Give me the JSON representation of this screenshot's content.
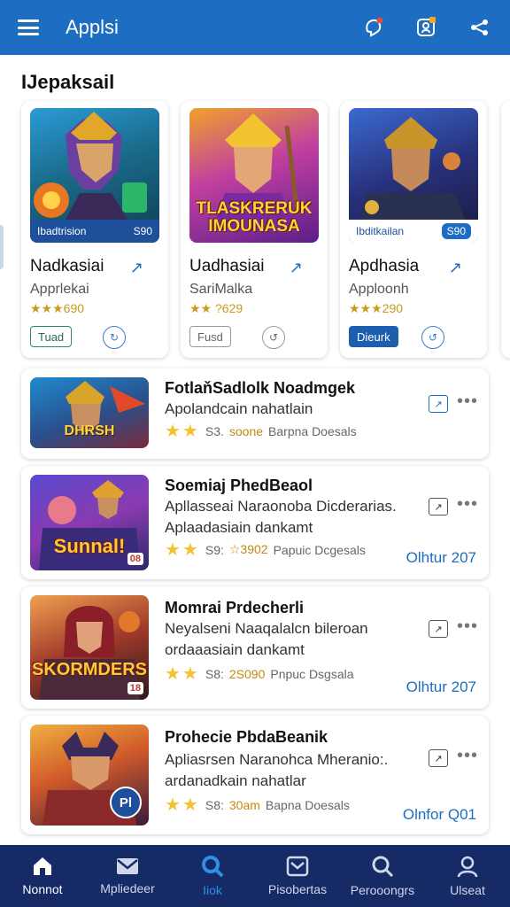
{
  "header": {
    "title": "Applsi",
    "icons": [
      "menu-icon",
      "notification-icon",
      "profile-icon",
      "share-icon"
    ]
  },
  "section_title": "IJepaksail",
  "featured": [
    {
      "art_caption": "Ibadtrision",
      "art_badge": "S90",
      "name": "Nadkasiai",
      "sub": "Apprlekai",
      "rating": "★★★690",
      "button": "Tuad",
      "circle": "↻"
    },
    {
      "art_caption": "TLASKRERUK IMOUNASA",
      "art_badge": "",
      "name": "Uadhasiai",
      "sub": "SariMalka",
      "rating": "★★ ?629",
      "button": "Fusd",
      "circle": "↺"
    },
    {
      "art_caption": "Ibditkailan",
      "art_badge": "S90",
      "name": "Apdhasia",
      "sub": "Apploonh",
      "rating": "★★★290",
      "button": "Dieurk",
      "circle": "↺"
    }
  ],
  "list": [
    {
      "title": "FotlaňSadlolk Noadmgek",
      "desc": [
        "Apolandcain nahatlain"
      ],
      "rating_prefix": "S3.",
      "rating_mid": "soone",
      "rating_suffix": "Barpna Doesals",
      "thumb_caption": "DHRSH",
      "date": ""
    },
    {
      "title": "Soemiaj PhedBeaol",
      "desc": [
        "Apllasseai Naraonoba Dicderarias.",
        "Aplaadasiain dankamt"
      ],
      "rating_prefix": "S9:",
      "rating_mid": "☆3902",
      "rating_suffix": "Papuic Dcgesals",
      "thumb_caption": "Sunnal!",
      "thumb_badge": "08",
      "date": "Olhtur 207"
    },
    {
      "title": "Momrai Prdecherli",
      "desc": [
        "Neyalseni Naaqalalcn bileroan",
        "ordaaasiain dankamt"
      ],
      "rating_prefix": "S8:",
      "rating_mid": "2S090",
      "rating_suffix": "Pnpuc Dsgsala",
      "thumb_caption": "SKORMDERS",
      "thumb_badge": "18",
      "date": "Olhtur 207"
    },
    {
      "title": "Prohecie PbdaBeanik",
      "desc": [
        "Apliasrsen Naranohca Mheranio:.",
        "ardanadkain nahatlar"
      ],
      "rating_prefix": "S8:",
      "rating_mid": "30am",
      "rating_suffix": "Bapna Doesals",
      "thumb_caption": "",
      "thumb_badge": "Pl",
      "date": "Olnfor Q01"
    }
  ],
  "nav": [
    {
      "label": "Nonnot",
      "icon": "home-icon"
    },
    {
      "label": "Mpliedeer",
      "icon": "mail-icon"
    },
    {
      "label": "Iiok",
      "icon": "search-icon",
      "active": true
    },
    {
      "label": "Pisobertas",
      "icon": "inbox-icon"
    },
    {
      "label": "Perooongrs",
      "icon": "search-icon"
    },
    {
      "label": "Ulseat",
      "icon": "user-icon"
    }
  ],
  "colors": {
    "header": "#1d6ec2",
    "nav_bg": "#162a66",
    "accent": "#1d6ec2",
    "star": "#f2c230"
  }
}
